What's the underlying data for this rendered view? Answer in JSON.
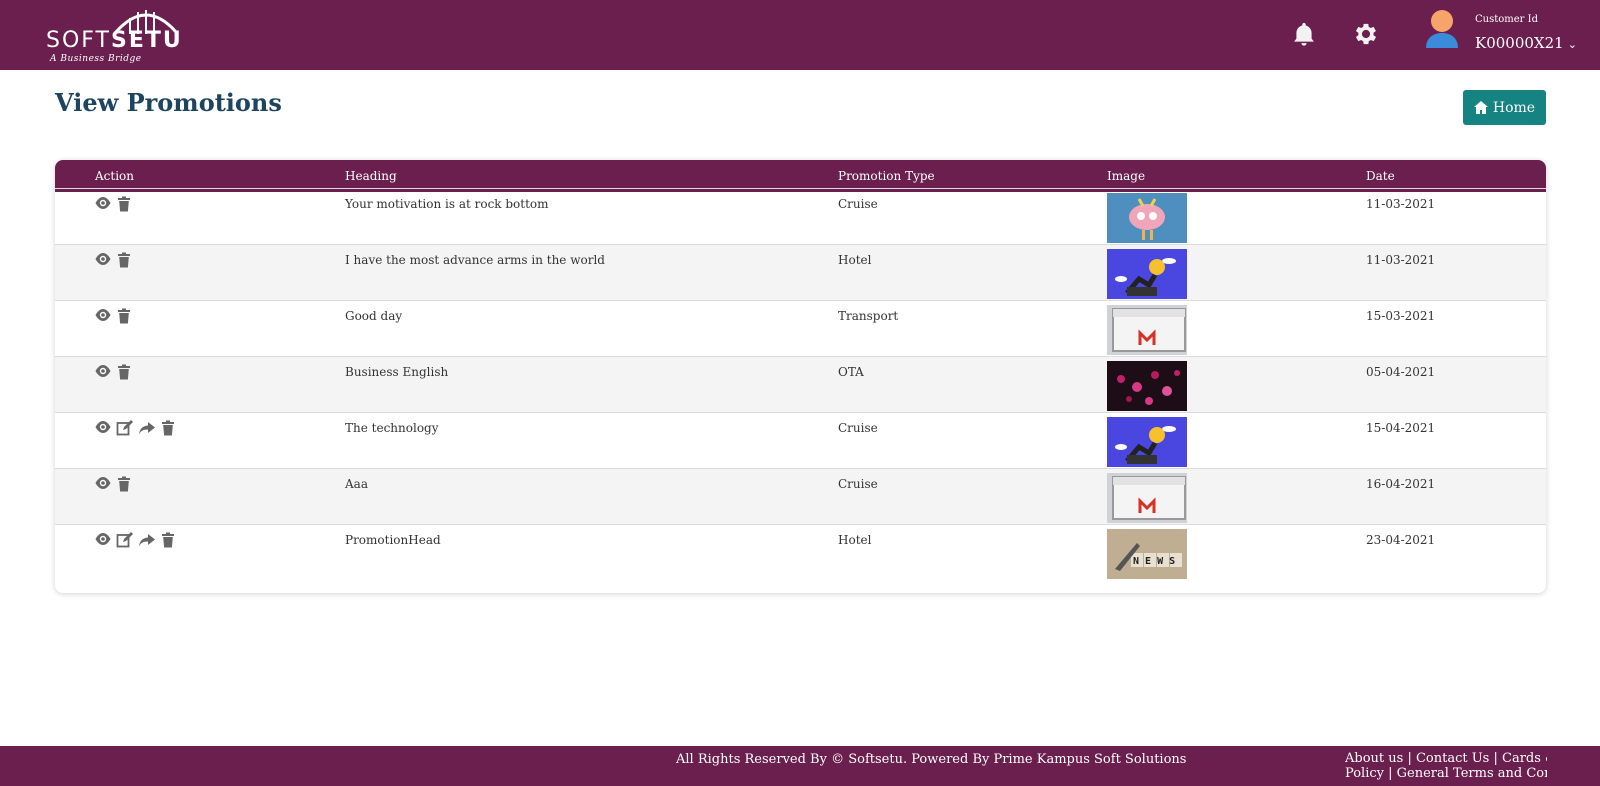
{
  "header": {
    "logo_soft": "SOFT",
    "logo_setu": "SETU",
    "logo_tagline": "A Business Bridge",
    "bell_icon": "bell-icon",
    "gear_icon": "gear-icon",
    "customer_label": "Customer Id",
    "customer_id": "K00000X21",
    "brand_color": "#6b1f4e"
  },
  "page": {
    "title": "View Promotions",
    "home_label": "Home",
    "home_color": "#148381"
  },
  "table": {
    "columns": [
      "Action",
      "Heading",
      "Promotion Type",
      "Image",
      "Date"
    ],
    "rows": [
      {
        "heading": "Your motivation is at rock bottom",
        "type": "Cruise",
        "image": "pink-brain-character",
        "date": "11-03-2021",
        "actions": [
          "view",
          "delete"
        ]
      },
      {
        "heading": "I have the most advance arms in the world",
        "type": "Hotel",
        "image": "robot-arm-emoji",
        "date": "11-03-2021",
        "actions": [
          "view",
          "delete"
        ]
      },
      {
        "heading": "Good day",
        "type": "Transport",
        "image": "gmail-screen",
        "date": "15-03-2021",
        "actions": [
          "view",
          "delete"
        ]
      },
      {
        "heading": "Business English",
        "type": "OTA",
        "image": "pink-flowers-dark",
        "date": "05-04-2021",
        "actions": [
          "view",
          "delete"
        ]
      },
      {
        "heading": "The technology",
        "type": "Cruise",
        "image": "robot-arm-emoji",
        "date": "15-04-2021",
        "actions": [
          "view",
          "edit",
          "share",
          "delete"
        ]
      },
      {
        "heading": "Aaa",
        "type": "Cruise",
        "image": "gmail-screen",
        "date": "16-04-2021",
        "actions": [
          "view",
          "delete"
        ]
      },
      {
        "heading": "PromotionHead",
        "type": "Hotel",
        "image": "news-blocks",
        "date": "23-04-2021",
        "actions": [
          "view",
          "edit",
          "share",
          "delete"
        ]
      }
    ]
  },
  "footer": {
    "rights": "All Rights Reserved By © Softsetu. Powered By Prime Kampus Soft Solutions",
    "about": "About us",
    "contact": "Contact Us",
    "cards": "Cards & Refund",
    "policy": "Policy",
    "terms": "General Terms and Conditions"
  }
}
